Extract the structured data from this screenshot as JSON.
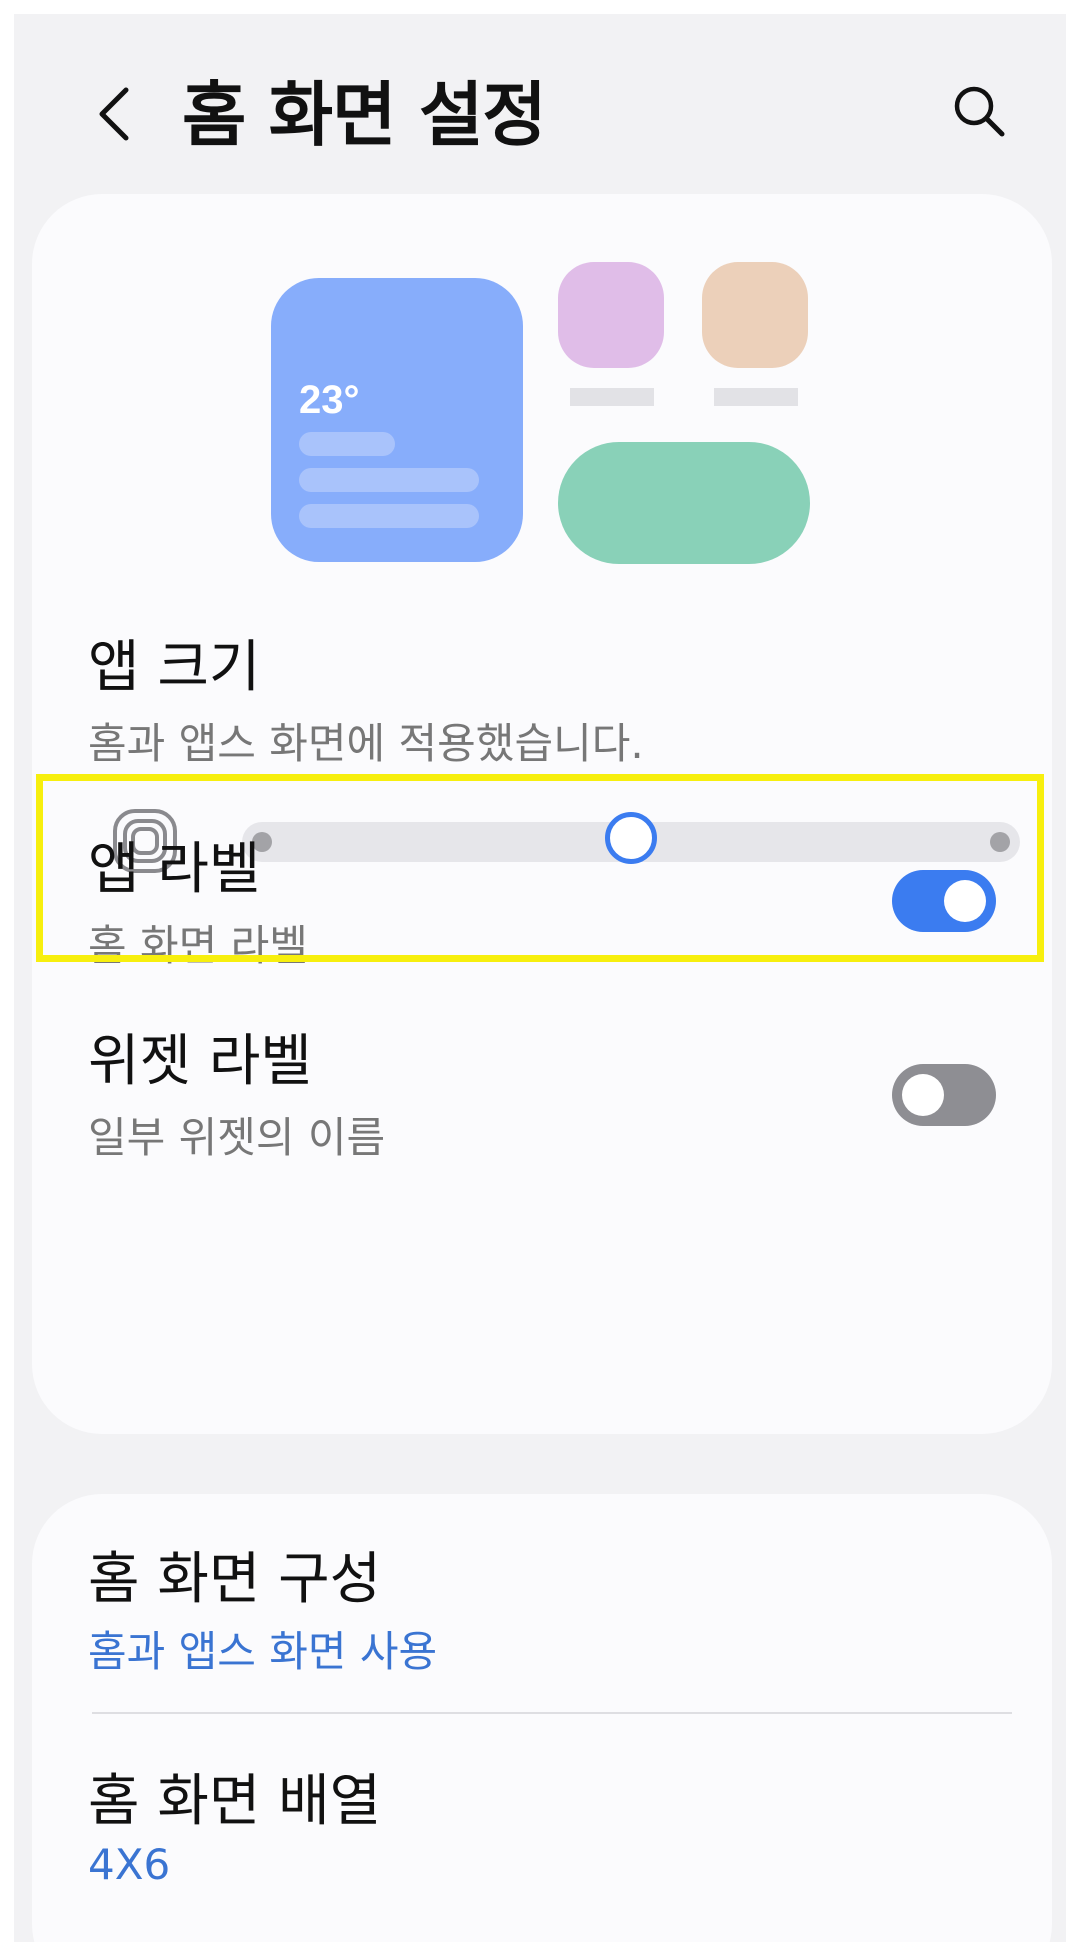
{
  "header": {
    "title": "홈 화면 설정"
  },
  "preview": {
    "weather_temp": "23°",
    "colors": {
      "weather": "#87adfb",
      "app1": "#e0bde8",
      "app2": "#ecd0ba",
      "pill": "#89d1b8"
    }
  },
  "app_size": {
    "title": "앱 크기",
    "subtitle": "홈과 앱스 화면에 적용했습니다.",
    "slider": {
      "steps": 3,
      "selected": 2
    }
  },
  "app_label": {
    "title": "앱 라벨",
    "subtitle": "홈 화면 라벨",
    "enabled": true
  },
  "widget_label": {
    "title": "위젯 라벨",
    "subtitle": "일부 위젯의 이름",
    "enabled": false
  },
  "home_layout": {
    "title": "홈 화면 구성",
    "value": "홈과 앱스 화면 사용"
  },
  "home_grid": {
    "title": "홈 화면 배열",
    "value": "4X6"
  },
  "colors": {
    "accent": "#3b7cf0",
    "link": "#3a74d2",
    "highlight": "#f7ef0e"
  }
}
